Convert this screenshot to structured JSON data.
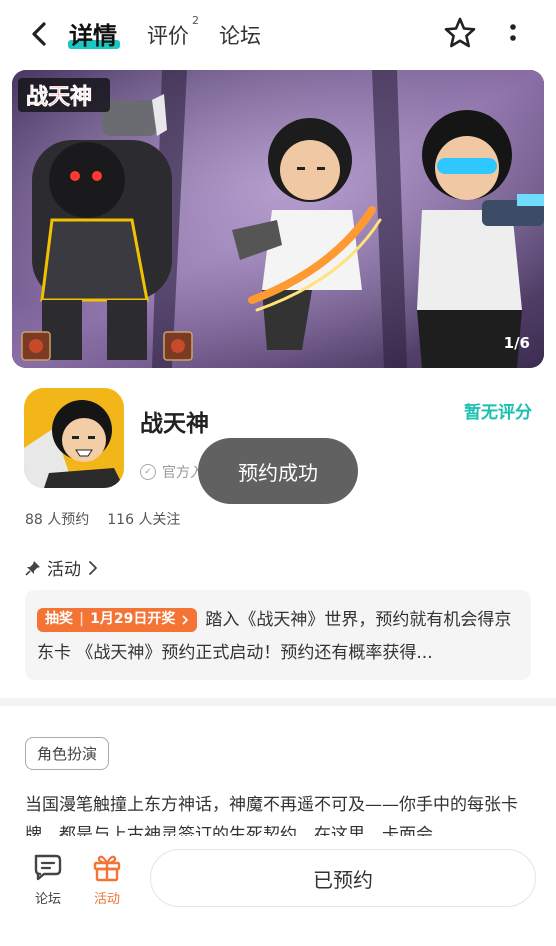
{
  "header": {
    "tabs": [
      {
        "label": "详情",
        "active": true
      },
      {
        "label": "评价",
        "badge": "2"
      },
      {
        "label": "论坛"
      }
    ],
    "accent_color": "#19c8c0"
  },
  "banner": {
    "logo_text": "战天神",
    "counter": "1/6"
  },
  "app": {
    "name": "战天神",
    "rating_text": "暂无评分",
    "official_text": "官方入驻",
    "reservations": "88 人预约",
    "followers": "116 人关注"
  },
  "toast": {
    "text": "预约成功"
  },
  "activity": {
    "title": "活动",
    "tag_label": "抽奖",
    "tag_date": "1月29日开奖",
    "text": "踏入《战天神》世界，预约就有机会得京东卡 《战天神》预约正式启动！预约还有概率获得..."
  },
  "genre_tag": "角色扮演",
  "description": "当国漫笔触撞上东方神话，神魔不再遥不可及——你手中的每张卡牌，都是与上古神灵签订的生死契约。在这里，卡面会",
  "bottom_bar": {
    "forum_label": "论坛",
    "activity_label": "活动",
    "reserve_button": "已预约",
    "activity_color": "#f47436"
  }
}
